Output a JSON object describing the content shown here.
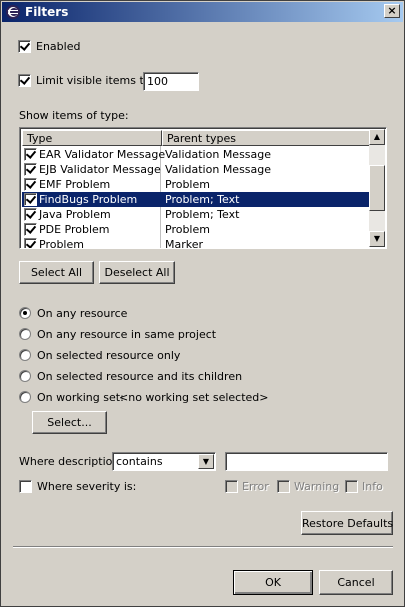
{
  "window": {
    "title": "Filters",
    "close_glyph": "×"
  },
  "enabled": {
    "label": "Enabled",
    "checked": true
  },
  "limit": {
    "label": "Limit visible items to:",
    "checked": true,
    "value": "100"
  },
  "types": {
    "label": "Show items of type:",
    "columns": [
      "Type",
      "Parent types"
    ],
    "rows": [
      {
        "type": "EAR Validator Message",
        "parent": "Validation Message",
        "checked": true
      },
      {
        "type": "EJB Validator Message",
        "parent": "Validation Message",
        "checked": true
      },
      {
        "type": "EMF Problem",
        "parent": "Problem",
        "checked": true
      },
      {
        "type": "FindBugs Problem",
        "parent": "Problem; Text",
        "checked": true,
        "selected": true
      },
      {
        "type": "Java Problem",
        "parent": "Problem; Text",
        "checked": true
      },
      {
        "type": "PDE Problem",
        "parent": "Problem",
        "checked": true
      },
      {
        "type": "Problem",
        "parent": "Marker",
        "checked": true
      }
    ]
  },
  "buttons": {
    "select_all": "Select All",
    "deselect_all": "Deselect All",
    "select": "Select...",
    "restore_defaults": "Restore Defaults",
    "ok": "OK",
    "cancel": "Cancel"
  },
  "scope": {
    "any_resource": "On any resource",
    "same_project": "On any resource in same project",
    "selected_only": "On selected resource only",
    "selected_children": "On selected resource and its children",
    "working_set": "On working set:",
    "working_set_value": "<no working set selected>",
    "selected_option": "any_resource"
  },
  "description": {
    "label": "Where description",
    "operator": "contains",
    "value": ""
  },
  "severity": {
    "label": "Where severity is:",
    "checked": false,
    "error": "Error",
    "warning": "Warning",
    "info": "Info"
  },
  "icons": {
    "app": "eclipse-icon",
    "close": "close-icon",
    "dropdown": "chevron-down-icon"
  }
}
